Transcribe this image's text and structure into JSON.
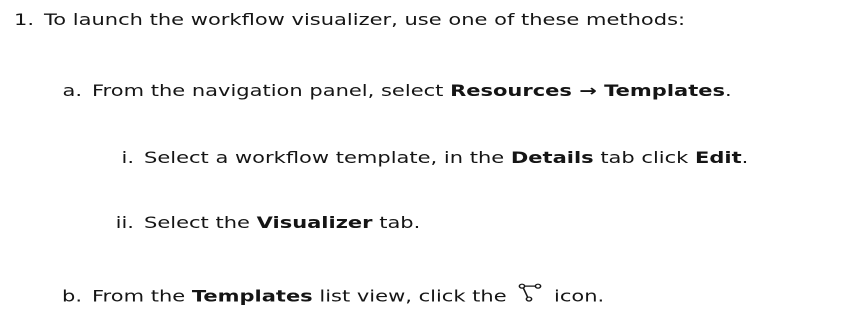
{
  "steps": {
    "step1": {
      "marker": "1.",
      "text": "To launch the workflow visualizer, use one of these methods:"
    },
    "step1a": {
      "marker": "a.",
      "prefix": "From the navigation panel, select ",
      "bold1": "Resources",
      "arrow": " → ",
      "bold2": "Templates",
      "suffix": "."
    },
    "step1a_i": {
      "marker": "i.",
      "prefix": "Select a workflow template, in the ",
      "bold1": "Details",
      "middle": " tab click ",
      "bold2": "Edit",
      "suffix": "."
    },
    "step1a_ii": {
      "marker": "ii.",
      "prefix": "Select the ",
      "bold1": "Visualizer",
      "suffix": " tab."
    },
    "step1b": {
      "marker": "b.",
      "prefix": "From the ",
      "bold1": "Templates",
      "middle": " list view, click the ",
      "icon": "workflow-visualizer-icon",
      "suffix": " icon."
    }
  }
}
